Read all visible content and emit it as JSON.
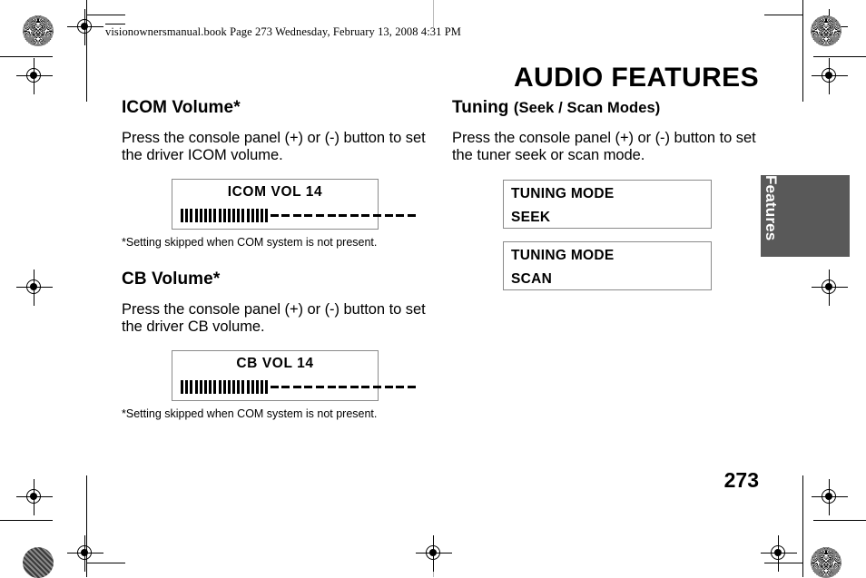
{
  "page": {
    "header_line": "visionownersmanual.book  Page 273  Wednesday, February 13, 2008  4:31 PM",
    "running_head": "AUDIO FEATURES",
    "folio": "273",
    "thumb_tab": "Features"
  },
  "left_column": {
    "sections": [
      {
        "heading": "ICOM Volume*",
        "body": "Press the console panel (+) or (-) button to set the driver ICOM volume.",
        "display": {
          "title": "ICOM VOL 14",
          "filled_segments": 19,
          "empty_segments": 13
        },
        "footnote": "*Setting skipped when COM system is not present."
      },
      {
        "heading": "CB Volume*",
        "body": "Press the console panel (+) or (-) button to set the driver CB volume.",
        "display": {
          "title": "CB VOL 14",
          "filled_segments": 19,
          "empty_segments": 13
        },
        "footnote": "*Setting skipped when COM system is not present."
      }
    ]
  },
  "right_column": {
    "sections": [
      {
        "heading_main": "Tuning ",
        "heading_rest": "(Seek / Scan Modes)",
        "body": "Press the console panel (+) or (-) button to set the tuner seek or scan mode.",
        "displays": [
          {
            "line1": "TUNING MODE",
            "line2": "SEEK"
          },
          {
            "line1": "TUNING MODE",
            "line2": "SCAN"
          }
        ]
      }
    ]
  },
  "colors": {
    "tab_background": "#595959",
    "tab_text": "#ffffff",
    "lcd_border": "#8a8a8a",
    "ink": "#000000"
  }
}
